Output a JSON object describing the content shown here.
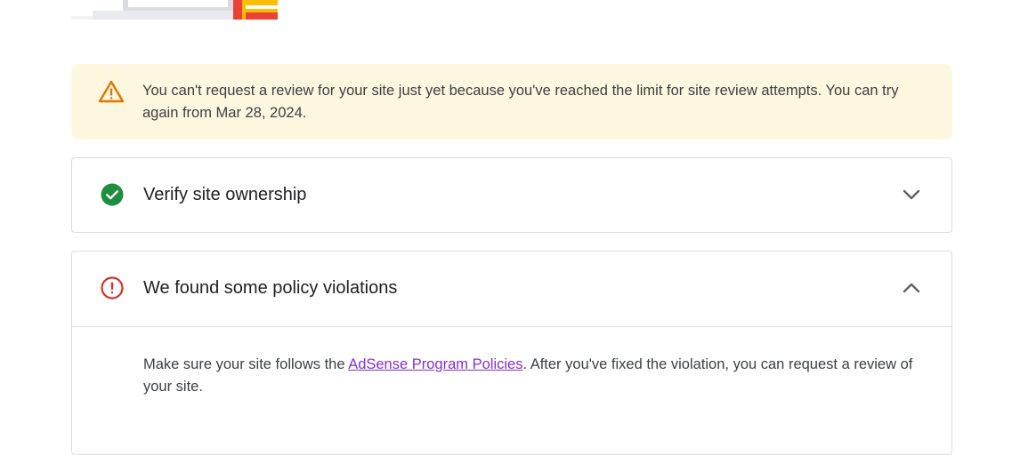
{
  "warning_banner": {
    "icon": "warning-triangle-icon",
    "text": "You can't request a review for your site just yet because you've reached the limit for site review attempts. You can try again from Mar 28, 2024."
  },
  "steps": {
    "verify": {
      "title": "Verify site ownership",
      "status_icon": "check-circle-icon",
      "expanded": false
    },
    "policy": {
      "title": "We found some policy violations",
      "status_icon": "error-circle-icon",
      "expanded": true,
      "body_before": "Make sure your site follows the ",
      "link_label": "AdSense Program Policies",
      "body_after": ". After you've fixed the violation, you can request a review of your site."
    }
  },
  "colors": {
    "banner_bg": "#fef7e0",
    "warning": "#e37400",
    "success": "#1e8e3e",
    "error": "#d93025",
    "link": "#8430ce"
  }
}
